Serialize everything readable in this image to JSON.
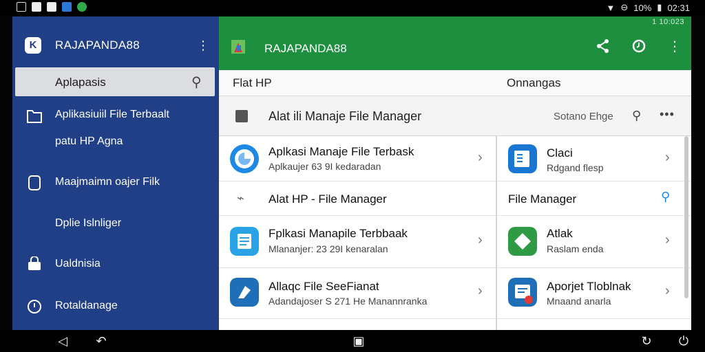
{
  "status": {
    "battery": "10%",
    "time": "02:31"
  },
  "drawer": {
    "title": "RAJAPANDA88",
    "active_item": "Aplapasis",
    "items": [
      {
        "line1": "Aplikasiuiil File Terbaalt",
        "line2": "patu HP Agna"
      },
      {
        "line1": "Maajmaimn oajer Filk"
      },
      {
        "line1": "Dplie Islnliger"
      },
      {
        "line1": "Ualdnisia"
      },
      {
        "line1": "Rotaldanage"
      }
    ]
  },
  "appbar": {
    "title": "RAJAPANDA88",
    "mini": "1 10:023"
  },
  "tabs": [
    "Flat HP",
    "Onnangas"
  ],
  "header": {
    "title": "Alat ili Manaje File Manager",
    "sort": "Sotano Ehge"
  },
  "left_list": [
    {
      "title": "Aplkasi Manaje File Terbask",
      "sub": "Aplkaujer 63 9I kedaradan",
      "color": "#1e88e5"
    },
    {
      "title": "Alat HP - File Manager",
      "sub": "",
      "color": ""
    },
    {
      "title": "Fplkasi Manapile Terbbaak",
      "sub": "Mlananjer: 23 29I kenaralan",
      "color": "#29a3e6"
    },
    {
      "title": "Allaqc File SeeFianat",
      "sub": "Adandajoser S 271 He Manannranka",
      "color": "#1f6fb8"
    }
  ],
  "right_list": [
    {
      "title": "Claci",
      "sub": "Rdgand flesp",
      "color": "#1976d2"
    },
    {
      "title": "File Manager",
      "sub": "",
      "color": ""
    },
    {
      "title": "Atlak",
      "sub": "Raslam enda",
      "color": "#2e9a44"
    },
    {
      "title": "Aporjet Tloblnak",
      "sub": "Mnaand anarla",
      "color": "#1f6fb8"
    }
  ]
}
